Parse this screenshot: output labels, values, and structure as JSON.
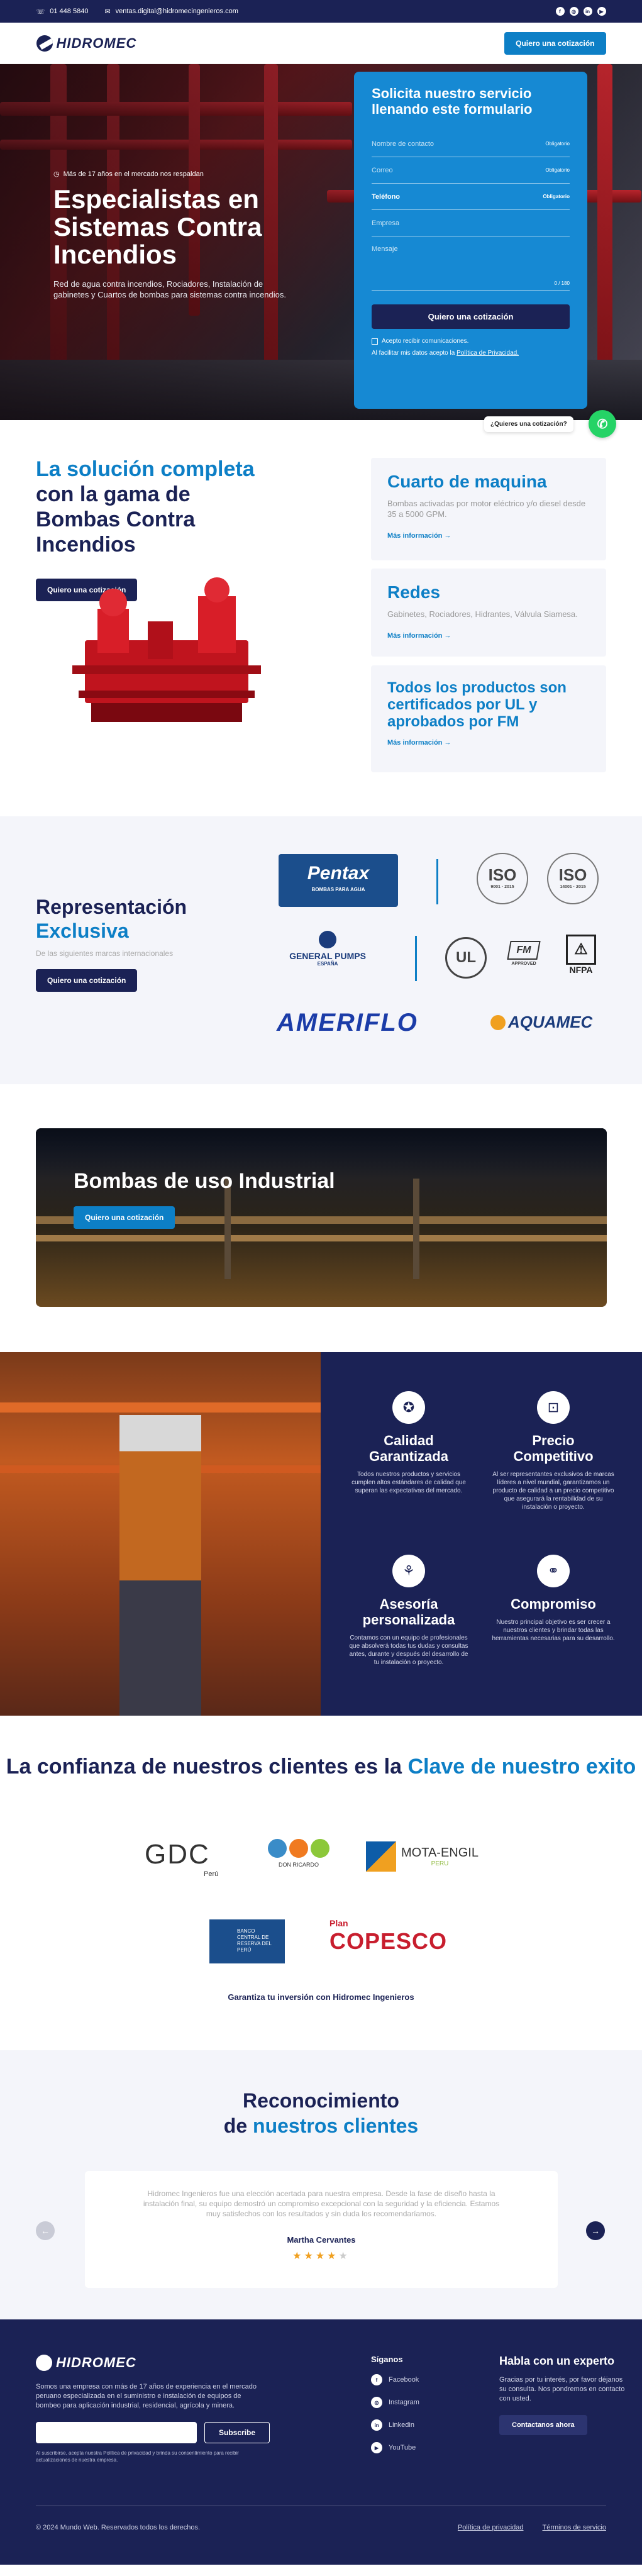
{
  "topbar": {
    "phone": "01 448 5840",
    "email": "ventas.digital@hidromecingenieros.com",
    "socials": [
      "facebook-icon",
      "instagram-icon",
      "linkedin-icon",
      "youtube-icon"
    ]
  },
  "header": {
    "logo": "HIDROMEC",
    "cta": "Quiero una cotización"
  },
  "hero": {
    "badge": "Más de 17 años en el mercado nos respaldan",
    "title": "Especialistas en Sistemas Contra Incendios",
    "subtitle": "Red de agua contra incendios, Rociadores, Instalación de gabinetes y Cuartos de bombas para sistemas contra incendios.",
    "form": {
      "title": "Solicita nuestro servicio llenando este formulario",
      "fields": [
        {
          "label": "Nombre de contacto",
          "req": "Obligatorio"
        },
        {
          "label": "Correo",
          "req": "Obligatorio"
        },
        {
          "label": "Teléfono",
          "req": "Obligatorio",
          "selected": true
        },
        {
          "label": "Empresa",
          "req": ""
        }
      ],
      "message": "Mensaje",
      "counter": "0 / 180",
      "submit": "Quiero una cotización",
      "consent": "Acepto recibir comunicaciones.",
      "recaptcha_prefix": "Al facilitar mis datos acepto la ",
      "recaptcha_link": "Política de Privacidad."
    }
  },
  "whatsapp": {
    "bubble": "¿Quieres una cotización?"
  },
  "solutions": {
    "title_hl": "La solución completa",
    "title_rest": "con la gama de Bombas Contra Incendios",
    "cta": "Quiero una cotización",
    "cards": [
      {
        "title": "Cuarto de maquina",
        "desc": "Bombas activadas por motor eléctrico y/o diesel desde 35 a 5000 GPM.",
        "link": "Más información →"
      },
      {
        "title": "Redes",
        "desc": "Gabinetes, Rociadores, Hidrantes, Válvula Siamesa.",
        "link": "Más información →"
      },
      {
        "title": "Todos los productos son certificados por UL y aprobados por FM",
        "desc": "",
        "link": "Más información →"
      }
    ]
  },
  "representation": {
    "title": "Representación",
    "title_hl": "Exclusiva",
    "subtitle": "De las siguientes marcas internacionales",
    "cta": "Quiero una cotización",
    "brands": {
      "pentax": "Pentax",
      "pentax_sub": "BOMBAS PARA AGUA",
      "iso1": "ISO",
      "iso1_sub": "9001 · 2015",
      "iso2": "ISO",
      "iso2_sub": "14001 · 2015",
      "general": "GENERAL PUMPS",
      "general_sub": "ESPAÑA",
      "ul": "UL",
      "fm": "FM",
      "fm_sub": "APPROVED",
      "nfpa": "NFPA",
      "ameriflo": "AMERIFLO",
      "aquamec": "AQUAMEC"
    }
  },
  "industrial": {
    "title": "Bombas de uso Industrial",
    "cta": "Quiero una cotización"
  },
  "features": [
    {
      "icon": "award-icon",
      "title": "Calidad Garantizada",
      "desc": "Todos nuestros productos y servicios cumplen altos estándares de calidad que superan las expectativas del mercado."
    },
    {
      "icon": "price-tag-icon",
      "title": "Precio Competitivo",
      "desc": "Al ser representantes exclusivos de marcas líderes a nivel mundial, garantizamos un producto de calidad a un precio competitivo que asegurará la rentabilidad de su instalación o proyecto."
    },
    {
      "icon": "handshake-icon",
      "title": "Asesoría personalizada",
      "desc": "Contamos con un equipo de profesionales que absolverá todas tus dudas y consultas antes, durante y después del desarrollo de tu instalación o proyecto."
    },
    {
      "icon": "agreement-icon",
      "title": "Compromiso",
      "desc": "Nuestro principal objetivo es ser crecer a nuestros clientes y brindar todas las herramientas necesarias para su desarrollo."
    }
  ],
  "clients": {
    "title": "La confianza de nuestros clientes es la",
    "title_hl": "Clave de nuestro exito",
    "logos": {
      "gdc": "GDC",
      "gdc_sub": "Perú",
      "donricardo": "DON RICARDO",
      "motaengil": "MOTA-ENGIL",
      "motaengil_sub": "PERU",
      "bcrp": "BANCO CENTRAL DE RESERVA DEL PERÚ",
      "plan": "Plan",
      "copesco": "COPESCO"
    },
    "footer": "Garantiza tu inversión con Hidromec Ingenieros"
  },
  "testimonials": {
    "title": "Reconocimiento",
    "title_pre": "de",
    "title_hl": "nuestros clientes",
    "text": "Hidromec Ingenieros fue una elección acertada para nuestra empresa. Desde la fase de diseño hasta la instalación final, su equipo demostró un compromiso excepcional con la seguridad y la eficiencia. Estamos muy satisfechos con los resultados y sin duda los recomendaríamos.",
    "name": "Martha Cervantes",
    "rating": 4,
    "prev": "←",
    "next": "→"
  },
  "footer": {
    "logo": "HIDROMEC",
    "desc": "Somos una empresa con más de 17 años de experiencia en el mercado peruano especializada en el suministro e instalación de equipos de bombeo para aplicación industrial, residencial, agrícola y minera.",
    "subscribe": "Subscribe",
    "small": "Al suscribirse, acepta nuestra Política de privacidad y brinda su consentimiento para recibir actualizaciones de nuestra empresa.",
    "social_title": "Síganos",
    "socials": [
      {
        "icon": "facebook-icon",
        "label": "Facebook"
      },
      {
        "icon": "instagram-icon",
        "label": "Instagram"
      },
      {
        "icon": "linkedin-icon",
        "label": "Linkedin"
      },
      {
        "icon": "youtube-icon",
        "label": "YouTube"
      }
    ],
    "cta_title": "Habla con un experto",
    "cta_text": "Gracias por tu interés, por favor déjanos su consulta. Nos pondremos en contacto con usted.",
    "cta_button": "Contactanos ahora",
    "copyright": "© 2024 Mundo Web. Reservados todos los derechos.",
    "privacy": "Política de privacidad",
    "terms": "Términos de servicio"
  }
}
